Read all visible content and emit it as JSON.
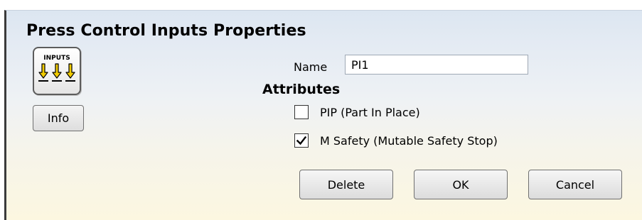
{
  "dialog": {
    "title": "Press Control Inputs Properties"
  },
  "icon": {
    "name": "inputs-icon",
    "caption": "INPUTS",
    "arrow_color": "#f2cc00"
  },
  "info_button": {
    "label": "Info"
  },
  "name_field": {
    "label": "Name",
    "value": "PI1"
  },
  "attributes": {
    "heading": "Attributes",
    "items": [
      {
        "label": "PIP (Part In Place)",
        "checked": false
      },
      {
        "label": "M Safety (Mutable Safety Stop)",
        "checked": true
      }
    ]
  },
  "buttons": {
    "delete": "Delete",
    "ok": "OK",
    "cancel": "Cancel"
  }
}
